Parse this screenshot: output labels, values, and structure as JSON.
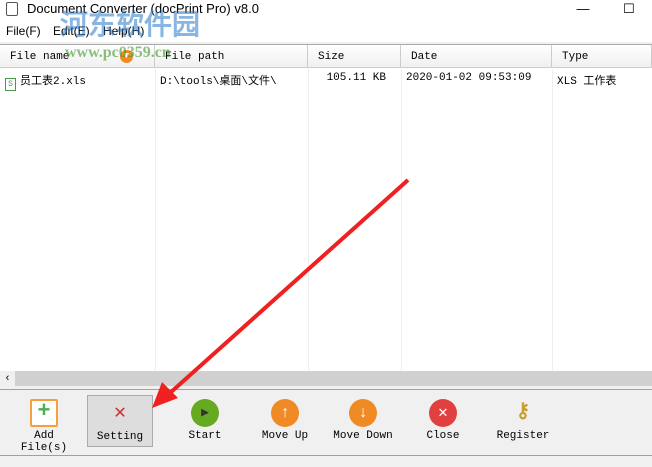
{
  "window": {
    "title": "Document Converter (docPrint Pro) v8.0",
    "minimize": "—",
    "maximize": "☐"
  },
  "menu": [
    "File(F)",
    "Edit(E)",
    "Help(H)"
  ],
  "columns": [
    "File name",
    "File path",
    "Size",
    "Date",
    "Type"
  ],
  "rows": [
    {
      "name": "员工表2.xls",
      "path": "D:\\tools\\桌面\\文件\\",
      "size": "105.11 KB",
      "date": "2020-01-02 09:53:09",
      "type": "XLS 工作表"
    }
  ],
  "toolbar": [
    "Add File(s)",
    "Setting",
    "Start",
    "Move Up",
    "Move Down",
    "Close",
    "Register"
  ],
  "watermark": {
    "name": "河东软件园",
    "url": "www.pc0359.cn"
  }
}
